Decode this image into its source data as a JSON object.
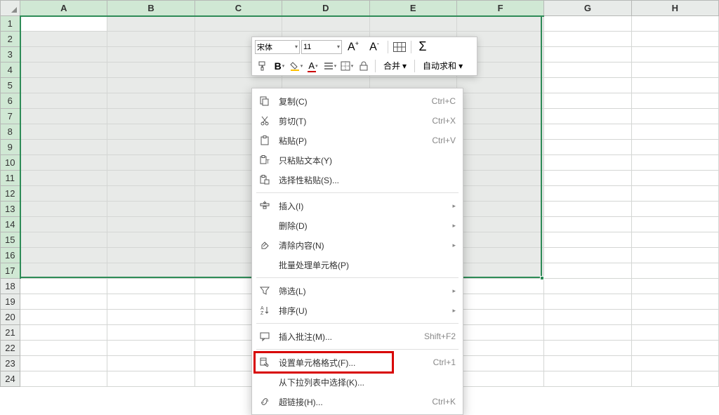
{
  "columns": [
    "A",
    "B",
    "C",
    "D",
    "E",
    "F",
    "G",
    "H"
  ],
  "rows": [
    1,
    2,
    3,
    4,
    5,
    6,
    7,
    8,
    9,
    10,
    11,
    12,
    13,
    14,
    15,
    16,
    17,
    18,
    19,
    20,
    21,
    22,
    23,
    24
  ],
  "selected_columns": [
    "A",
    "B",
    "C",
    "D",
    "E",
    "F"
  ],
  "selected_rows": [
    1,
    2,
    3,
    4,
    5,
    6,
    7,
    8,
    9,
    10,
    11,
    12,
    13,
    14,
    15,
    16,
    17
  ],
  "mini_toolbar": {
    "font_name": "宋体",
    "font_size": "11",
    "font_increase": "A⁺",
    "font_decrease": "A⁻",
    "merge_label": "合并",
    "autosum_label": "自动求和"
  },
  "context_menu": {
    "items": [
      {
        "icon": "copy",
        "label": "复制(C)",
        "shortcut": "Ctrl+C"
      },
      {
        "icon": "cut",
        "label": "剪切(T)",
        "shortcut": "Ctrl+X"
      },
      {
        "icon": "paste",
        "label": "粘贴(P)",
        "shortcut": "Ctrl+V"
      },
      {
        "icon": "paste-text",
        "label": "只粘贴文本(Y)",
        "shortcut": ""
      },
      {
        "icon": "paste-special",
        "label": "选择性粘贴(S)...",
        "shortcut": ""
      },
      {
        "sep": true
      },
      {
        "icon": "insert",
        "label": "插入(I)",
        "submenu": true
      },
      {
        "icon": "",
        "label": "删除(D)",
        "submenu": true
      },
      {
        "icon": "clear",
        "label": "清除内容(N)",
        "submenu": true
      },
      {
        "icon": "",
        "label": "批量处理单元格(P)",
        "shortcut": ""
      },
      {
        "sep": true
      },
      {
        "icon": "filter",
        "label": "筛选(L)",
        "submenu": true
      },
      {
        "icon": "sort",
        "label": "排序(U)",
        "submenu": true
      },
      {
        "sep": true
      },
      {
        "icon": "comment",
        "label": "插入批注(M)...",
        "shortcut": "Shift+F2"
      },
      {
        "sep": true
      },
      {
        "icon": "format-cells",
        "label": "设置单元格格式(F)...",
        "shortcut": "Ctrl+1",
        "highlight": true
      },
      {
        "icon": "",
        "label": "从下拉列表中选择(K)...",
        "shortcut": ""
      },
      {
        "icon": "hyperlink",
        "label": "超链接(H)...",
        "shortcut": "Ctrl+K"
      }
    ]
  }
}
